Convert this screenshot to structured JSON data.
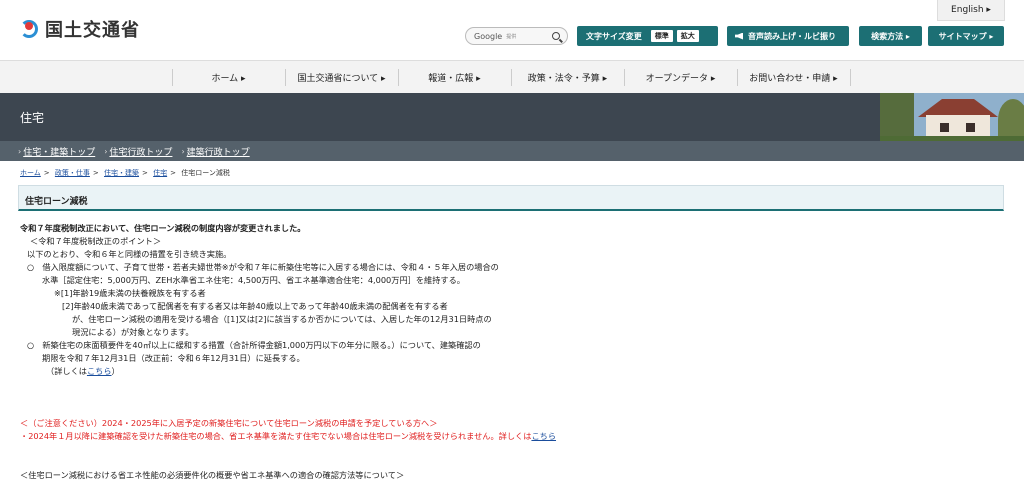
{
  "header": {
    "logo_text": "国土交通省",
    "english_label": "English ▸",
    "search": {
      "brand": "Google",
      "tag": "提供"
    },
    "font_size": {
      "label": "文字サイズ変更",
      "standard": "標準",
      "large": "拡大"
    },
    "voice_label": "音声読み上げ・ルビ振り",
    "howto_label": "検索方法 ▸",
    "sitemap_label": "サイトマップ ▸"
  },
  "gnav": [
    "ホーム ▸",
    "国土交通省について ▸",
    "報道・広報 ▸",
    "政策・法令・予算 ▸",
    "オープンデータ ▸",
    "お問い合わせ・申請 ▸"
  ],
  "band": {
    "title": "住宅"
  },
  "subnav": [
    "住宅・建築トップ",
    "住宅行政トップ",
    "建築行政トップ"
  ],
  "breadcrumb": {
    "items": [
      "ホーム",
      "政策・仕事",
      "住宅・建築",
      "住宅"
    ],
    "current": "住宅ローン減税"
  },
  "page": {
    "heading": "住宅ローン減税"
  },
  "content": {
    "l1": "令和７年度税制改正において、住宅ローン減税の制度内容が変更されました。",
    "l2": "＜令和７年度税制改正のポイント＞",
    "l3": "以下のとおり、令和６年と同様の措置を引き続き実施。",
    "l4": "○　借入限度額について、子育て世帯・若者夫婦世帯※が令和７年に新築住宅等に入居する場合には、令和４・５年入居の場合の",
    "l5": "水準［認定住宅：5,000万円、ZEH水準省エネ住宅：4,500万円、省エネ基準適合住宅：4,000万円］を維持する。",
    "l6": "※[1]年齢19歳未満の扶養親族を有する者",
    "l7": "[2]年齢40歳未満であって配偶者を有する者又は年齢40歳以上であって年齢40歳未満の配偶者を有する者",
    "l8": "が、住宅ローン減税の適用を受ける場合（[1]又は[2]に該当するか否かについては、入居した年の12月31日時点の",
    "l9": "現況による）が対象となります。",
    "l10": "○　新築住宅の床面積要件を40㎡以上に緩和する措置（合計所得金額1,000万円以下の年分に限る。）について、建築確認の",
    "l11": "期限を令和７年12月31日（改正前：令和６年12月31日）に延長する。",
    "l12_pre": "（詳しくは",
    "l12_link": "こちら",
    "l12_post": "）",
    "r1": "＜（ご注意ください）2024・2025年に入居予定の新築住宅について住宅ローン減税の申請を予定している方へ＞",
    "r2_pre": "・2024年１月以降に建築確認を受けた新築住宅の場合、省エネ基準を満たす住宅でない場合は住宅ローン減税を受けられません。詳しくは",
    "r2_link": "こちら",
    "l13": "＜住宅ローン減税における省エネ性能の必須要件化の概要や省エネ基準への適合の確認方法等について＞"
  }
}
